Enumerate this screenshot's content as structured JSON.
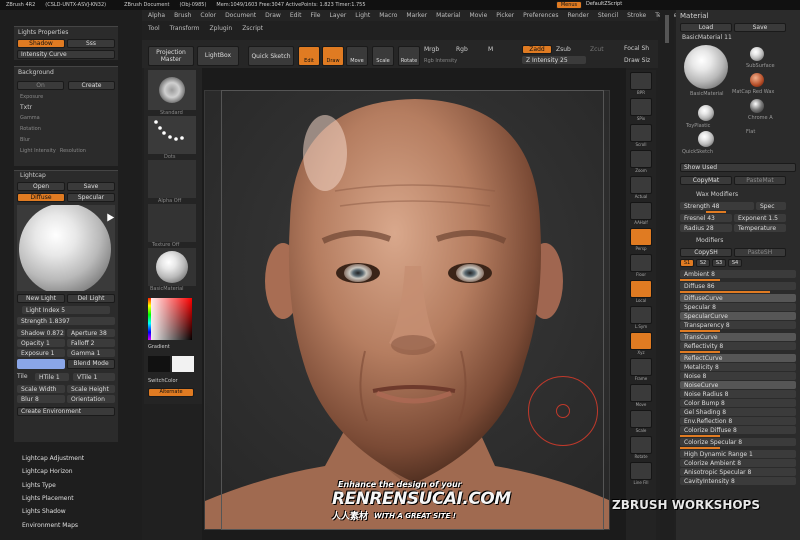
{
  "title_bar": {
    "app": "ZBrush 4R2",
    "build": "(CSLD-UNTX-ASVJ-KN32)",
    "doc": "ZBrush Document",
    "mem": "(Obj-0985)",
    "info": "Mem:1049/1603 Free:3047 ActivePoints: 1.823 Timer:1.755",
    "menus_btn": "Menus",
    "script_btn": "DefaultZScript"
  },
  "menu_bar": [
    "Alpha",
    "Brush",
    "Color",
    "Document",
    "Draw",
    "Edit",
    "File",
    "Layer",
    "Light",
    "Macro",
    "Marker",
    "Material",
    "Movie",
    "Picker",
    "Preferences",
    "Render",
    "Stencil",
    "Stroke",
    "Texture"
  ],
  "sub_menu": [
    "Tool",
    "Transform",
    "Zplugin",
    "Zscript"
  ],
  "toolbar": {
    "projection_master": "Projection Master",
    "lightbox": "LightBox",
    "quick_sketch": "Quick Sketch",
    "edit": "Edit",
    "draw": "Draw",
    "move": "Move",
    "scale": "Scale",
    "rotate": "Rotate",
    "mrgb": "Mrgb",
    "rgb": "Rgb",
    "m": "M",
    "zadd": "Zadd",
    "zsub": "Zsub",
    "zcut": "Zcut",
    "rgb_intensity": "Rgb Intensity",
    "z_intensity": "Z Intensity 25",
    "focal_shift": "Focal Sh",
    "draw_size": "Draw Siz"
  },
  "left_palette": {
    "lights_properties": {
      "header": "Lights Properties",
      "shadow": "Shadow",
      "sss": "Sss",
      "intensity_curve": "Intensity Curve"
    },
    "background": {
      "header": "Background",
      "on": "On",
      "create": "Create",
      "texture": "Txtr",
      "exposure": "Exposure",
      "gamma": "Gamma",
      "rotation": "Rotation",
      "blur": "Blur",
      "gradient": "Gradient",
      "light_intensity": "Light Intensity",
      "resolution": "Resolution"
    },
    "lightcap": {
      "header": "Lightcap",
      "open": "Open",
      "save": "Save",
      "diffuse": "Diffuse",
      "specular": "Specular",
      "new_light": "New Light",
      "del_light": "Del Light",
      "light_index": "Light Index 5",
      "strength": "Strength 1.8397",
      "shadow": "Shadow 0.872",
      "aperture": "Aperture 38",
      "opacity": "Opacity 1",
      "falloff": "Falloff 2",
      "exposure": "Exposure 1",
      "gamma": "Gamma 1",
      "blend_mode": "Blend Mode",
      "tile": "Tile",
      "h_tile": "HTile 1",
      "v_tile": "VTile 1",
      "scale_width": "Scale Width",
      "scale_height": "Scale Height",
      "blur": "Blur 8",
      "orientation": "Orientation",
      "create_environment": "Create Environment"
    },
    "menu_items": [
      "Lightcap Adjustment",
      "Lightcap Horizon",
      "Lights Type",
      "Lights Placement",
      "Lights Shadow",
      "Environment Maps"
    ]
  },
  "tool_column": {
    "items": [
      "Standard",
      "Dots",
      "Alpha Off",
      "Texture Off",
      "BasicMaterial"
    ],
    "gradient": "Gradient",
    "switch_color": "SwitchColor",
    "alternate": "Alternate"
  },
  "right_shelf": [
    "BPR",
    "SPix",
    "Scroll",
    "Zoom",
    "Actual",
    "AAHalf",
    "Persp",
    "Floor",
    "Local",
    "L.Sym",
    "Xyz",
    "Frame",
    "Move",
    "Scale",
    "Rotate",
    "Line Fill",
    "PolyF",
    "Transp",
    "Ghost",
    "Solo",
    "Xpose"
  ],
  "material_panel": {
    "header": "Material",
    "load": "Load",
    "save": "Save",
    "current": "BasicMaterial 11",
    "thumbs": [
      "BasicMaterial",
      "SubSurface",
      "MatCap Red Wax",
      "Chrome A",
      "ToyPlastic",
      "QuickSketch",
      "Flat"
    ],
    "show_used": "Show Used",
    "copy_mat": "CopyMat",
    "paste_mat": "PasteMat",
    "wax": {
      "header": "Wax Modifiers",
      "strength": "Strength 48",
      "spec": "Spec",
      "fresnel": "Fresnel 43",
      "exponent": "Exponent 1.5",
      "radius": "Radius 28",
      "temperature": "Temperature"
    },
    "modifiers": {
      "header": "Modifiers",
      "copy_sh": "CopySH",
      "paste_sh": "PasteSH",
      "items": [
        "Ambient 8",
        "Diffuse 86",
        "DiffuseCurve",
        "Specular 8",
        "SpecularCurve",
        "Transparency 8",
        "TransCurve",
        "Reflectivity 8",
        "ReflectCurve",
        "Metalicity 8",
        "Noise 8",
        "NoiseCurve",
        "Noise Radius 8",
        "Color Bump 8",
        "Gel Shading 8",
        "Env.Reflection 8",
        "Colorize Diffuse 8",
        "Colorize Specular 8",
        "High Dynamic Range 1",
        "Colorize Ambient 8",
        "Anisotropic Specular 8",
        "CavityIntensity 8"
      ]
    }
  },
  "watermarks": {
    "zbrush": "ZBRUSH WORKSHOPS",
    "enhance": "Enhance the design of your",
    "site": "RENRENSUCAI.COM",
    "cn": "人人素材",
    "tagline": "WITH A GREAT SITE !"
  }
}
